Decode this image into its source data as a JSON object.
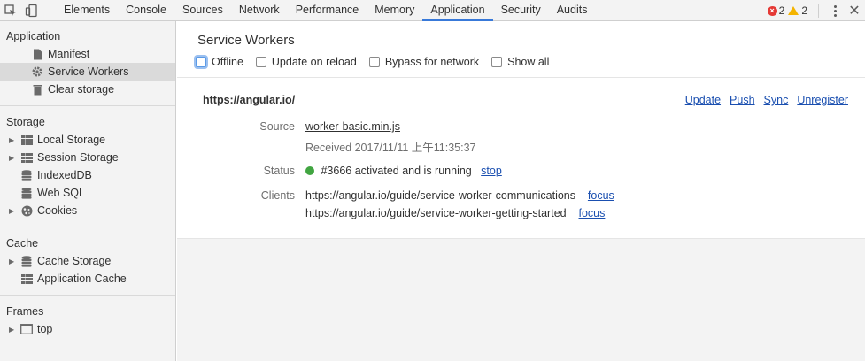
{
  "toolbar": {
    "tabs": [
      "Elements",
      "Console",
      "Sources",
      "Network",
      "Performance",
      "Memory",
      "Application",
      "Security",
      "Audits"
    ],
    "active_tab": "Application",
    "error_count": "2",
    "warning_count": "2"
  },
  "sidebar": {
    "application": {
      "title": "Application",
      "items": [
        "Manifest",
        "Service Workers",
        "Clear storage"
      ]
    },
    "storage": {
      "title": "Storage",
      "items": [
        "Local Storage",
        "Session Storage",
        "IndexedDB",
        "Web SQL",
        "Cookies"
      ]
    },
    "cache": {
      "title": "Cache",
      "items": [
        "Cache Storage",
        "Application Cache"
      ]
    },
    "frames": {
      "title": "Frames",
      "items": [
        "top"
      ]
    }
  },
  "main": {
    "title": "Service Workers",
    "options": [
      "Offline",
      "Update on reload",
      "Bypass for network",
      "Show all"
    ],
    "origin": "https://angular.io/",
    "actions": [
      "Update",
      "Push",
      "Sync",
      "Unregister"
    ],
    "source_label": "Source",
    "source_file": "worker-basic.min.js",
    "received": "Received 2017/11/11 上午11:35:37",
    "status_label": "Status",
    "status_text": "#3666 activated and is running",
    "status_action": "stop",
    "clients_label": "Clients",
    "clients": [
      {
        "url": "https://angular.io/guide/service-worker-communications",
        "action": "focus"
      },
      {
        "url": "https://angular.io/guide/service-worker-getting-started",
        "action": "focus"
      }
    ]
  },
  "colors": {
    "accent": "#3879d9",
    "link": "#1a4fb0",
    "status_running": "#41a541",
    "error": "#e53935",
    "warning": "#f4b400"
  }
}
